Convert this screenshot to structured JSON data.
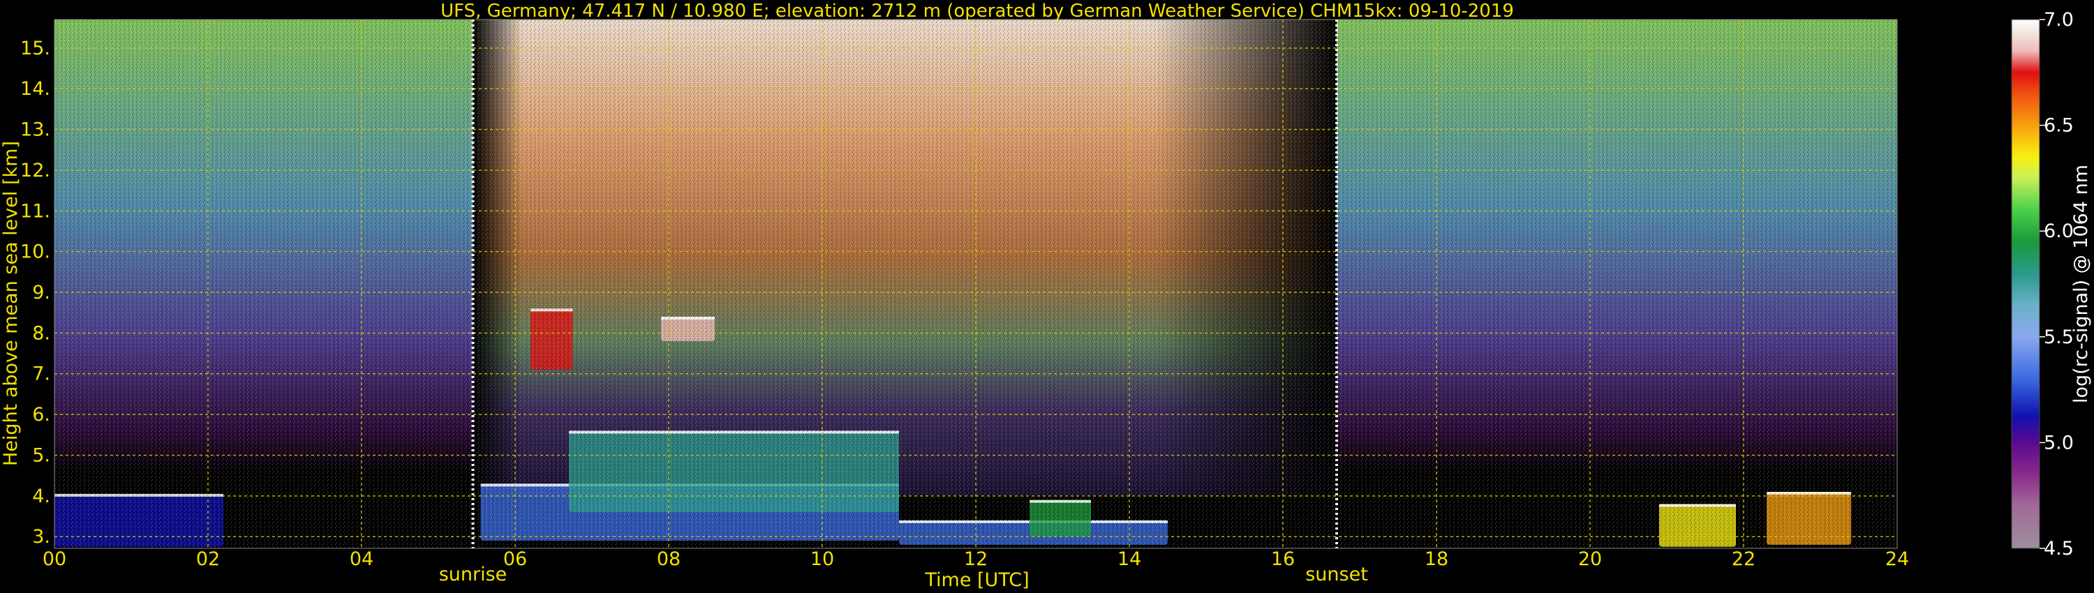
{
  "chart_data": {
    "type": "heatmap",
    "title": "UFS, Germany; 47.417 N / 10.980 E; elevation: 2712 m  (operated by German Weather Service)    CHM15kx: 09-10-2019",
    "xlabel": "Time [UTC]",
    "ylabel": "Height above mean sea level [km]",
    "colorbar_label": "log(rc-signal) @ 1064 nm",
    "xlim": [
      0,
      24
    ],
    "ylim": [
      2.712,
      15.7
    ],
    "x_ticks": [
      "00",
      "02",
      "04",
      "06",
      "08",
      "10",
      "12",
      "14",
      "16",
      "18",
      "20",
      "22",
      "24"
    ],
    "y_ticks": [
      "3.",
      "4.",
      "5.",
      "6.",
      "7.",
      "8.",
      "9.",
      "10.",
      "11.",
      "12.",
      "13.",
      "14.",
      "15."
    ],
    "colorbar_range": [
      4.5,
      7.0
    ],
    "colorbar_ticks": [
      "4.5",
      "5.0",
      "5.5",
      "6.0",
      "6.5",
      "7.0"
    ],
    "grid": true,
    "events": [
      {
        "label": "sunrise",
        "time": 5.45
      },
      {
        "label": "sunset",
        "time": 16.7
      }
    ],
    "signal_regions": [
      {
        "t0": 0.0,
        "t1": 2.2,
        "h0": 2.75,
        "h1": 4.05,
        "value": 5.0
      },
      {
        "t0": 5.55,
        "t1": 11.0,
        "h0": 2.9,
        "h1": 4.3,
        "value": 5.2
      },
      {
        "t0": 6.7,
        "t1": 11.0,
        "h0": 3.6,
        "h1": 5.6,
        "value": 5.6
      },
      {
        "t0": 6.2,
        "t1": 6.75,
        "h0": 7.1,
        "h1": 8.6,
        "value": 6.6
      },
      {
        "t0": 7.9,
        "t1": 8.6,
        "h0": 7.8,
        "h1": 8.4,
        "value": 6.8
      },
      {
        "t0": 11.0,
        "t1": 14.5,
        "h0": 2.8,
        "h1": 3.4,
        "value": 5.3
      },
      {
        "t0": 12.7,
        "t1": 13.5,
        "h0": 3.0,
        "h1": 3.9,
        "value": 5.8
      },
      {
        "t0": 20.9,
        "t1": 21.9,
        "h0": 2.75,
        "h1": 3.8,
        "value": 6.0
      },
      {
        "t0": 22.3,
        "t1": 23.4,
        "h0": 2.8,
        "h1": 4.1,
        "value": 6.2
      }
    ],
    "colors": {
      "text": "#f2e200",
      "grid": "#d8c800",
      "colorbar_text": "#ffffff",
      "event_line": "#ffffff",
      "background": "#000000"
    }
  }
}
